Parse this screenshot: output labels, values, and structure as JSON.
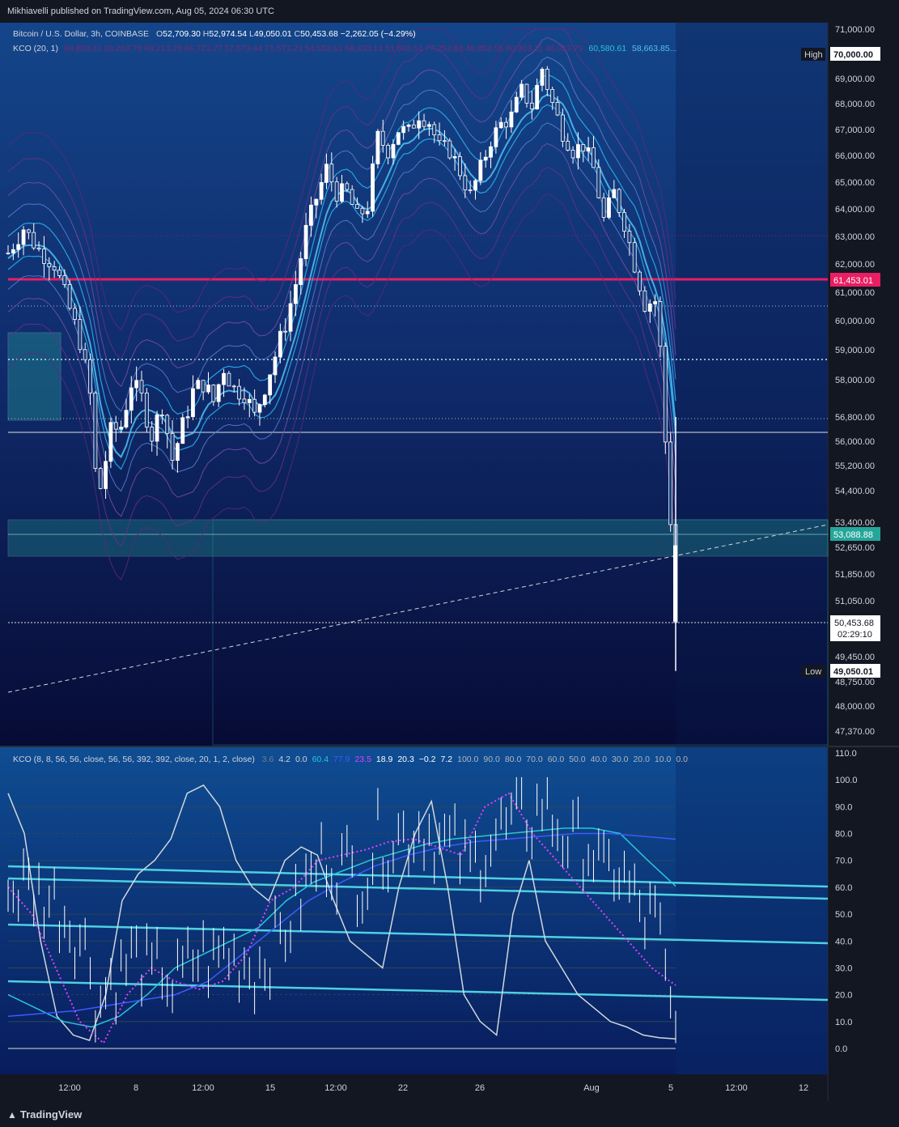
{
  "header": {
    "published": "Mikhiavelli published on TradingView.com, Aug 05, 2024 06:30 UTC"
  },
  "main_legend": {
    "symbol": "Bitcoin / U.S. Dollar, 3h, COINBASE",
    "o_label": "O",
    "o": "52,709.30",
    "h_label": "H",
    "h": "52,974.54",
    "l_label": "L",
    "l": "49,050.01",
    "c_label": "C",
    "c": "50,453.68",
    "change": "−2,262.05 (−4.29%)"
  },
  "kco_legend": {
    "name": "KCO (20, 1)",
    "faded_values": "69,893.31  63,263.79  60,213.29  66,723.27  57,573.44  71,573.23  54,553.61  68,433.14  51,603.51  77,253.83  48,853.55  80,303.11  46,013.79",
    "v1": "60,580.61",
    "v2": "58,663.85..."
  },
  "osc_legend": {
    "name": "KCO (8, 8, 56, 56, close, 56, 56, 392, 392, close, 20, 1, 2, close)",
    "values": [
      {
        "v": "3.6",
        "color": "#787b86"
      },
      {
        "v": "4.2",
        "color": "#d1d4dc"
      },
      {
        "v": "0.0",
        "color": "#d1d4dc"
      },
      {
        "v": "60.4",
        "color": "#26c6da"
      },
      {
        "v": "77.9",
        "color": "#3d5afe"
      },
      {
        "v": "23.5",
        "color": "#e040fb"
      },
      {
        "v": "18.9",
        "color": "#ffffff"
      },
      {
        "v": "20.3",
        "color": "#ffffff"
      },
      {
        "v": "−0.2",
        "color": "#ffffff"
      },
      {
        "v": "7.2",
        "color": "#ffffff"
      },
      {
        "v": "100.0",
        "color": "#b2b5be"
      },
      {
        "v": "90.0",
        "color": "#b2b5be"
      },
      {
        "v": "80.0",
        "color": "#b2b5be"
      },
      {
        "v": "70.0",
        "color": "#b2b5be"
      },
      {
        "v": "60.0",
        "color": "#b2b5be"
      },
      {
        "v": "50.0",
        "color": "#b2b5be"
      },
      {
        "v": "40.0",
        "color": "#b2b5be"
      },
      {
        "v": "30.0",
        "color": "#b2b5be"
      },
      {
        "v": "20.0",
        "color": "#b2b5be"
      },
      {
        "v": "10.0",
        "color": "#b2b5be"
      },
      {
        "v": "0.0",
        "color": "#b2b5be"
      }
    ]
  },
  "footer": {
    "brand": "TradingView"
  },
  "colors": {
    "background_top": "#123a78",
    "background_bottom": "#0a0f3a",
    "candle": "#ffffff",
    "red_line": "#e91e63",
    "zone": "#26a69a",
    "osc_cyan": "#26c6da",
    "osc_blue": "#3d5afe",
    "osc_magenta": "#e040fb"
  },
  "chart_data": [
    {
      "type": "candlestick",
      "title": "Bitcoin / U.S. Dollar, 3h, COINBASE",
      "ylim": [
        46800,
        71300
      ],
      "yticks": [
        "71,000.00",
        "70,000.00",
        "69,000.00",
        "68,000.00",
        "67,000.00",
        "66,000.00",
        "65,000.00",
        "64,000.00",
        "63,000.00",
        "62,000.00",
        "61,000.00",
        "60,000.00",
        "59,000.00",
        "58,000.00",
        "56,800.00",
        "56,000.00",
        "55,200.00",
        "54,400.00",
        "53,400.00",
        "52,650.00",
        "51,850.00",
        "51,050.00",
        "49,450.00",
        "48,750.00",
        "48,000.00",
        "47,370.00"
      ],
      "xticks": [
        "12:00",
        "8",
        "12:00",
        "15",
        "12:00",
        "22",
        "26",
        "Aug",
        "5",
        "12:00",
        "12"
      ],
      "close_path": [
        [
          0,
          62400
        ],
        [
          3,
          63300
        ],
        [
          6,
          62500
        ],
        [
          9,
          62000
        ],
        [
          12,
          60400
        ],
        [
          14,
          59300
        ],
        [
          16,
          57500
        ],
        [
          17,
          55000
        ],
        [
          18,
          54500
        ],
        [
          20,
          56300
        ],
        [
          22,
          56500
        ],
        [
          24,
          57900
        ],
        [
          26,
          57400
        ],
        [
          28,
          56200
        ],
        [
          30,
          57200
        ],
        [
          32,
          55400
        ],
        [
          34,
          56500
        ],
        [
          36,
          57600
        ],
        [
          38,
          57900
        ],
        [
          40,
          57300
        ],
        [
          42,
          58400
        ],
        [
          44,
          57700
        ],
        [
          46,
          57600
        ],
        [
          48,
          56800
        ],
        [
          50,
          57800
        ],
        [
          52,
          58800
        ],
        [
          54,
          59900
        ],
        [
          56,
          61300
        ],
        [
          58,
          63200
        ],
        [
          60,
          64400
        ],
        [
          62,
          65500
        ],
        [
          64,
          64600
        ],
        [
          66,
          64600
        ],
        [
          68,
          63700
        ],
        [
          70,
          64100
        ],
        [
          72,
          66700
        ],
        [
          74,
          66200
        ],
        [
          76,
          67000
        ],
        [
          78,
          66900
        ],
        [
          80,
          67600
        ],
        [
          82,
          67300
        ],
        [
          84,
          66300
        ],
        [
          86,
          66200
        ],
        [
          88,
          65400
        ],
        [
          90,
          64500
        ],
        [
          92,
          65500
        ],
        [
          94,
          66600
        ],
        [
          96,
          67200
        ],
        [
          98,
          67500
        ],
        [
          100,
          68500
        ],
        [
          102,
          67900
        ],
        [
          104,
          69400
        ],
        [
          106,
          68000
        ],
        [
          108,
          66900
        ],
        [
          110,
          66200
        ],
        [
          112,
          66400
        ],
        [
          114,
          65500
        ],
        [
          116,
          63600
        ],
        [
          118,
          64600
        ],
        [
          120,
          63500
        ],
        [
          122,
          62000
        ],
        [
          124,
          60600
        ],
        [
          126,
          60700
        ],
        [
          127,
          59000
        ],
        [
          128,
          56000
        ],
        [
          129,
          53500
        ],
        [
          130,
          50453.68
        ]
      ],
      "annotations": {
        "high": {
          "label": "High",
          "value": "70,000.00"
        },
        "low": {
          "label": "Low",
          "value": "49,050.01"
        },
        "red_level": "61,453.01",
        "zone_level": "53,088.88",
        "last_price": "50,453.68",
        "countdown": "02:29:10"
      }
    },
    {
      "type": "line",
      "title": "KCO oscillator",
      "ylim": [
        0,
        110
      ],
      "yticks": [
        "110.0",
        "100.0",
        "90.0",
        "80.0",
        "70.0",
        "60.0",
        "50.0",
        "40.0",
        "30.0",
        "20.0",
        "10.0",
        "0.0"
      ],
      "series": [
        {
          "values": [
            95,
            80,
            40,
            12,
            5,
            3,
            20,
            55,
            65,
            70,
            78,
            95,
            98,
            90,
            70,
            60,
            55,
            70,
            75,
            72,
            55,
            40,
            35,
            30,
            60,
            80,
            92,
            60,
            20,
            10,
            5,
            50,
            70,
            40,
            30,
            20,
            15,
            10,
            8,
            5,
            4,
            3.6
          ]
        },
        {
          "values": [
            20,
            15,
            10,
            8,
            12,
            20,
            30,
            35,
            40,
            45,
            55,
            62,
            66,
            70,
            73,
            76,
            78,
            79,
            80,
            81,
            82,
            82,
            80,
            70,
            60.4
          ]
        },
        {
          "values": [
            12,
            13,
            14,
            16,
            18,
            20,
            25,
            35,
            45,
            55,
            62,
            68,
            72,
            75,
            77,
            78,
            79,
            80,
            80,
            79,
            77.9
          ]
        },
        {
          "values": [
            60,
            50,
            30,
            10,
            2,
            20,
            30,
            25,
            22,
            25,
            35,
            55,
            60,
            70,
            72,
            74,
            77,
            78,
            75,
            72,
            90,
            95,
            80,
            70,
            60,
            50,
            40,
            30,
            23.5
          ]
        }
      ]
    }
  ]
}
